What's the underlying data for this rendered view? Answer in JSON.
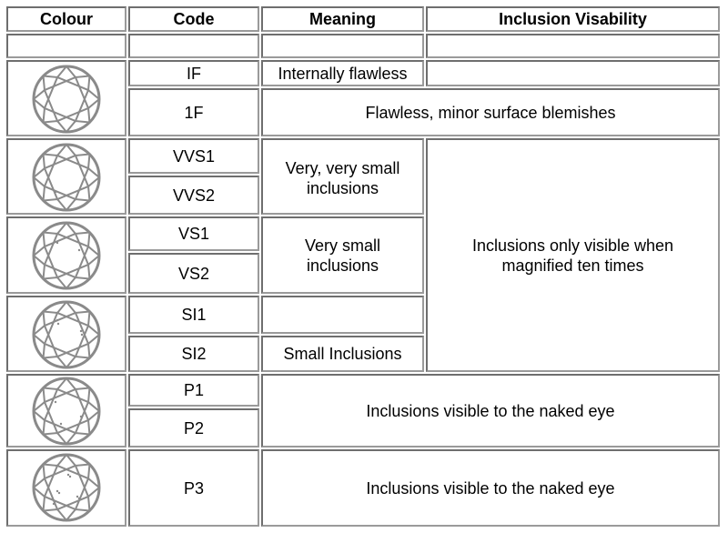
{
  "headers": [
    "Colour",
    "Code",
    "Meaning",
    "Inclusion Visability"
  ],
  "rows": {
    "if": {
      "code": "IF",
      "meaning": "Internally flawless",
      "visibility": ""
    },
    "one_f": {
      "code": "1F",
      "meaning_visibility": "Flawless, minor surface blemishes"
    },
    "vvs1": {
      "code": "VVS1"
    },
    "vvs2": {
      "code": "VVS2"
    },
    "vvs_meaning": "Very, very small inclusions",
    "vs1": {
      "code": "VS1"
    },
    "vs2": {
      "code": "VS2"
    },
    "vs_meaning": "Very small inclusions",
    "magnified_visibility": "Inclusions only visible when magnified ten times",
    "si1": {
      "code": "SI1",
      "meaning": ""
    },
    "si2": {
      "code": "SI2",
      "meaning": "Small Inclusions"
    },
    "p1": {
      "code": "P1"
    },
    "p2": {
      "code": "P2"
    },
    "p12_visibility": "Inclusions visible to the naked eye",
    "p3": {
      "code": "P3",
      "visibility": "Inclusions visible to the naked eye"
    }
  },
  "icons": {
    "diamond_flawless": "diamond-flawless-icon",
    "diamond_vvs": "diamond-vvs-icon",
    "diamond_vs": "diamond-vs-icon",
    "diamond_si": "diamond-si-icon",
    "diamond_p12": "diamond-p1-p2-icon",
    "diamond_p3": "diamond-p3-icon"
  },
  "colors": {
    "border": "#6e6e6e",
    "diamond_stroke": "#8a8a8a"
  }
}
